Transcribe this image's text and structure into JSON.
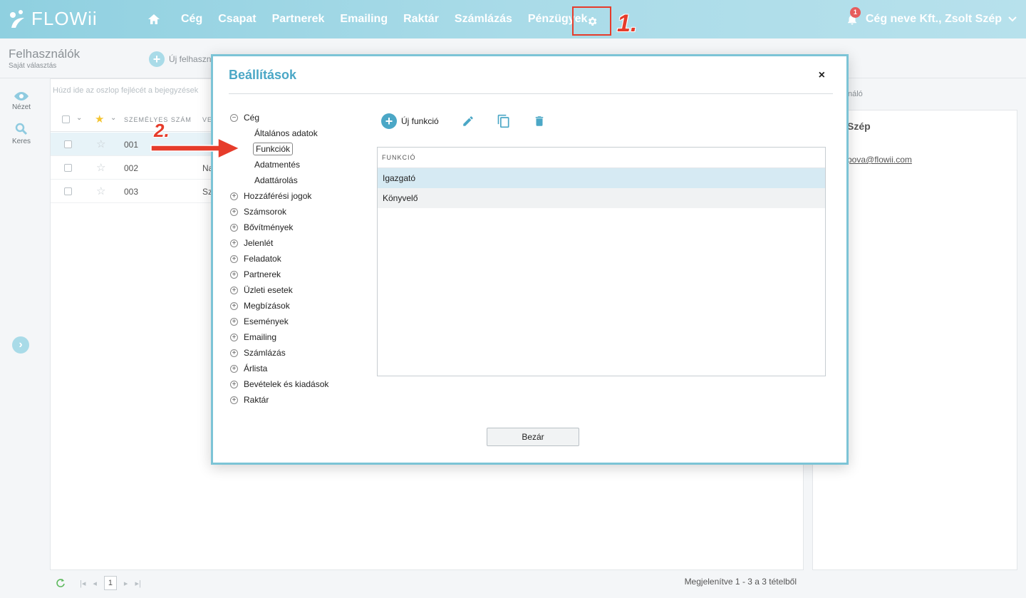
{
  "app": {
    "logo_text": "FLOWii",
    "nav": [
      "Cég",
      "Csapat",
      "Partnerek",
      "Emailing",
      "Raktár",
      "Számlázás",
      "Pénzügyek"
    ],
    "notification_count": "1",
    "user_label": "Cég neve Kft., Zsolt Szép"
  },
  "annotations": {
    "step1": "1.",
    "step2": "2."
  },
  "page": {
    "title": "Felhasználók",
    "subtitle": "Saját választás",
    "new_user_label": "Új felhaszn"
  },
  "rail": {
    "view_label": "Nézet",
    "search_label": "Keres"
  },
  "grid": {
    "group_hint": "Húzd ide az oszlop fejlécét a bejegyzések",
    "columns": [
      "SZEMÉLYES SZÁM",
      "VE"
    ],
    "rows": [
      {
        "num": "001",
        "name": ""
      },
      {
        "num": "002",
        "name": "Na"
      },
      {
        "num": "003",
        "name": "Sz"
      }
    ]
  },
  "right_panel": {
    "tab_label": "náló",
    "name": "Szép",
    "email": "pova@flowii.com"
  },
  "footer": {
    "current_page": "1",
    "info": "Megjelenítve 1 - 3 a 3 tételből"
  },
  "modal": {
    "title": "Beállítások",
    "close_x": "×",
    "tree_root": "Cég",
    "tree_root_sign": "−",
    "tree_children": [
      "Általános adatok",
      "Funkciók",
      "Adatmentés",
      "Adattárolás"
    ],
    "tree_sections": [
      "Hozzáférési jogok",
      "Számsorok",
      "Bővítmények",
      "Jelenlét",
      "Feladatok",
      "Partnerek",
      "Üzleti esetek",
      "Megbízások",
      "Események",
      "Emailing",
      "Számlázás",
      "Árlista",
      "Bevételek és kiadások",
      "Raktár"
    ],
    "tree_sign": "+",
    "new_function_label": "Új funkció",
    "table_header": "FUNKCIÓ",
    "functions": [
      "Igazgató",
      "Könyvelő"
    ],
    "close_button": "Bezár"
  },
  "colors": {
    "accent": "#4ba7c6",
    "annotation_red": "#e63c2b",
    "topbar": "#a9dbe8"
  }
}
